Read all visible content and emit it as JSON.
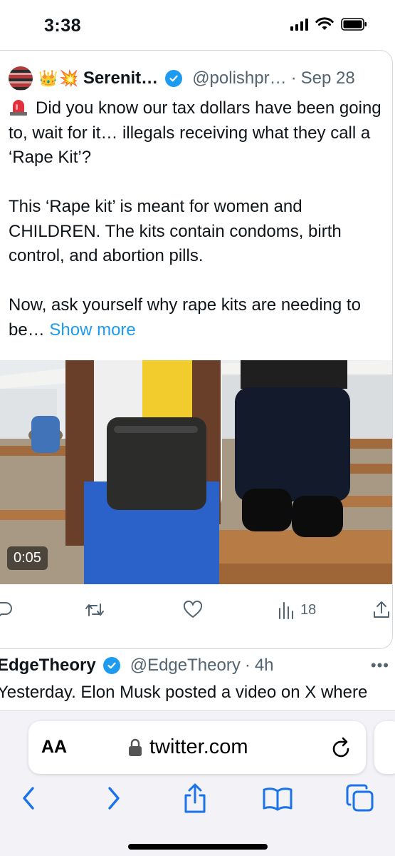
{
  "status_bar": {
    "time": "3:38"
  },
  "tweet": {
    "display_name": "Serenit…",
    "emojis": [
      "👑",
      "💥"
    ],
    "handle": "@polishpr…",
    "separator": "·",
    "time": "Sep 28",
    "paragraphs": [
      "Did you know our tax dollars have been going to, wait for it… illegals receiving what they call a ‘Rape Kit’?",
      "This ‘Rape kit’ is meant for women and CHILDREN. The kits contain condoms, birth control, and abortion pills."
    ],
    "last_paragraph": "Now, ask yourself why rape kits are needing to be… ",
    "show_more": "Show more",
    "video_duration": "0:05",
    "actions": {
      "views": "18"
    }
  },
  "tweet2": {
    "display_name": "EdgeTheory",
    "handle": "@EdgeTheory",
    "separator": "·",
    "time": "4h",
    "more": "•••",
    "text": "Yesterday. Elon Musk posted a video on X where"
  },
  "browser": {
    "aa_label": "AA",
    "url": "twitter.com"
  },
  "icons": {
    "reply": "reply-icon",
    "retweet": "retweet-icon",
    "like": "heart-icon",
    "views": "views-icon",
    "share": "share-icon"
  }
}
